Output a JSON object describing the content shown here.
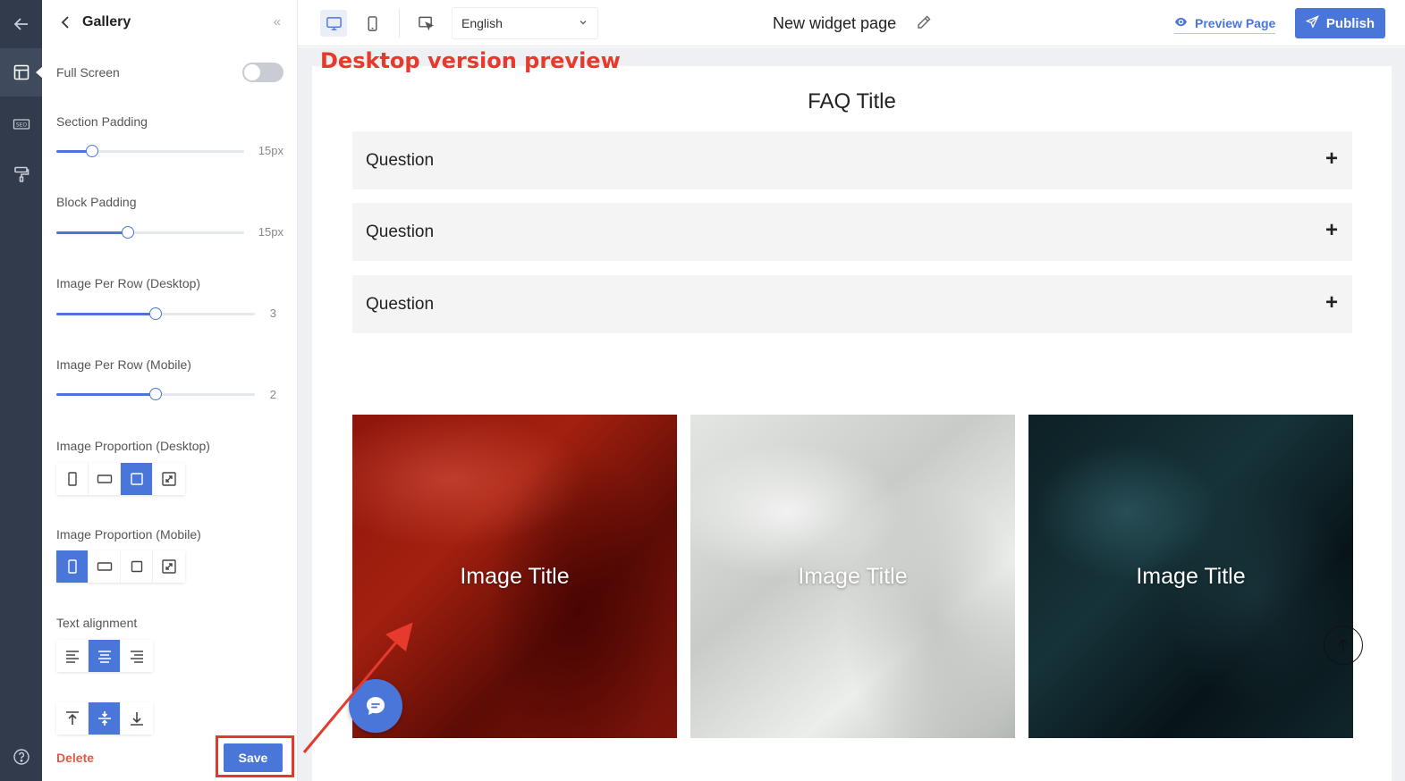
{
  "panel": {
    "title": "Gallery",
    "full_screen_label": "Full Screen",
    "full_screen_on": false,
    "section_padding": {
      "label": "Section Padding",
      "value": "15px",
      "level": 0.19
    },
    "block_padding": {
      "label": "Block Padding",
      "value": "15px",
      "level": 0.38
    },
    "per_row_desktop": {
      "label": "Image Per Row (Desktop)",
      "value": "3",
      "level": 0.5
    },
    "per_row_mobile": {
      "label": "Image Per Row (Mobile)",
      "value": "2",
      "level": 0.5
    },
    "proportion_desktop_label": "Image Proportion (Desktop)",
    "proportion_mobile_label": "Image Proportion (Mobile)",
    "text_alignment_label": "Text alignment",
    "delete_label": "Delete",
    "save_label": "Save"
  },
  "toolbar": {
    "language": "English",
    "page_name": "New widget page",
    "preview_label": "Preview Page",
    "publish_label": "Publish"
  },
  "annotation": "Desktop version preview",
  "preview": {
    "faq_title": "FAQ Title",
    "questions": [
      "Question",
      "Question",
      "Question"
    ],
    "images": [
      {
        "title": "Image Title"
      },
      {
        "title": "Image Title"
      },
      {
        "title": "Image Title"
      }
    ]
  },
  "colors": {
    "accent": "#4a76d9",
    "danger": "#e05a4a",
    "annotation": "#e53a2c",
    "rail": "#313b4c"
  }
}
